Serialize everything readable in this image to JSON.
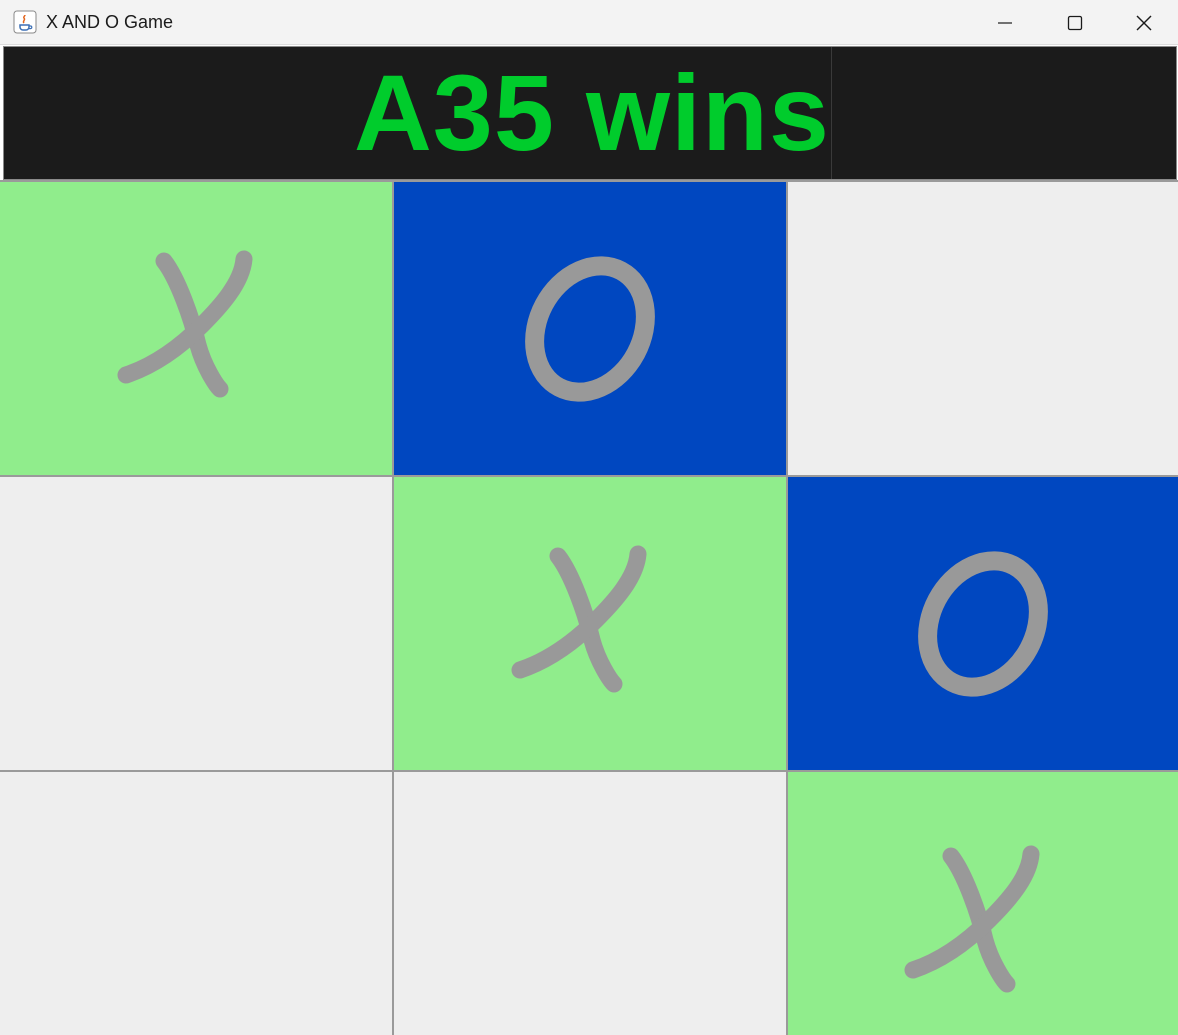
{
  "window": {
    "title": "X AND O Game",
    "controls": {
      "minimize": "minimize-icon",
      "maximize": "maximize-icon",
      "close": "close-icon"
    }
  },
  "status": {
    "message": "A35 wins",
    "color": "#00cc2c",
    "background": "#1b1b1b"
  },
  "colors": {
    "x_cell": "#90ed8c",
    "o_cell": "#0047c0",
    "empty_cell": "#eeeeee",
    "mark": "#999999",
    "grid": "#9a9a9a"
  },
  "board": {
    "rows": [
      [
        {
          "mark": "X",
          "fill": "x"
        },
        {
          "mark": "O",
          "fill": "o"
        },
        {
          "mark": "",
          "fill": "empty"
        }
      ],
      [
        {
          "mark": "",
          "fill": "empty"
        },
        {
          "mark": "X",
          "fill": "x"
        },
        {
          "mark": "O",
          "fill": "o"
        }
      ],
      [
        {
          "mark": "",
          "fill": "empty"
        },
        {
          "mark": "",
          "fill": "empty"
        },
        {
          "mark": "X",
          "fill": "x"
        }
      ]
    ]
  }
}
